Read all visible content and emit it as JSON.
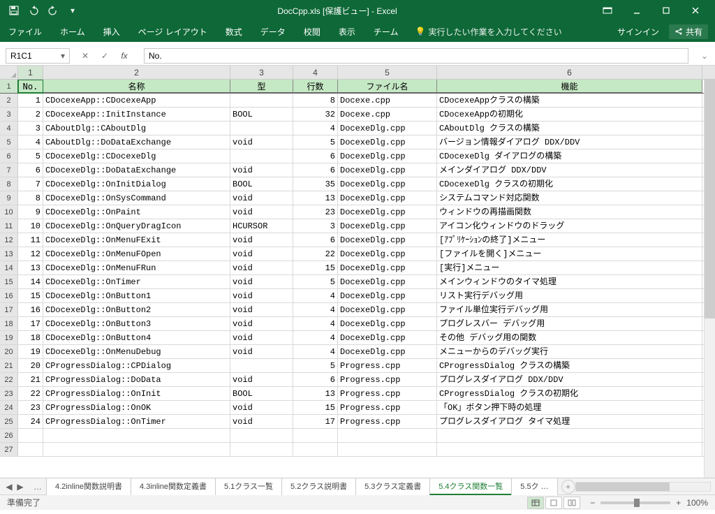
{
  "title": "DocCpp.xls [保護ビュー] - Excel",
  "qat": {
    "save": "保存",
    "undo": "元に戻す",
    "redo": "やり直し"
  },
  "ribbon": [
    "ファイル",
    "ホーム",
    "挿入",
    "ページ レイアウト",
    "数式",
    "データ",
    "校閲",
    "表示",
    "チーム"
  ],
  "tell_me": "実行したい作業を入力してください",
  "signin": "サインイン",
  "share": "共有",
  "namebox": "R1C1",
  "fx_value": "No.",
  "col_numbers": [
    "1",
    "2",
    "3",
    "4",
    "5",
    "6"
  ],
  "headers": {
    "c1": "No.",
    "c2": "名称",
    "c3": "型",
    "c4": "行数",
    "c5": "ファイル名",
    "c6": "機能"
  },
  "rows": [
    {
      "n": "1",
      "name": "CDocexeApp::CDocexeApp",
      "type": "",
      "lines": "8",
      "file": "Docexe.cpp",
      "func": "CDocexeAppクラスの構築"
    },
    {
      "n": "2",
      "name": "CDocexeApp::InitInstance",
      "type": "BOOL",
      "lines": "32",
      "file": "Docexe.cpp",
      "func": "CDocexeAppの初期化"
    },
    {
      "n": "3",
      "name": "CAboutDlg::CAboutDlg",
      "type": "",
      "lines": "4",
      "file": "DocexeDlg.cpp",
      "func": "CAboutDlg クラスの構築"
    },
    {
      "n": "4",
      "name": "CAboutDlg::DoDataExchange",
      "type": "void",
      "lines": "5",
      "file": "DocexeDlg.cpp",
      "func": "バージョン情報ダイアログ DDX/DDV"
    },
    {
      "n": "5",
      "name": "CDocexeDlg::CDocexeDlg",
      "type": "",
      "lines": "6",
      "file": "DocexeDlg.cpp",
      "func": "CDocexeDlg ダイアログの構築"
    },
    {
      "n": "6",
      "name": "CDocexeDlg::DoDataExchange",
      "type": "void",
      "lines": "6",
      "file": "DocexeDlg.cpp",
      "func": "メインダイアログ DDX/DDV"
    },
    {
      "n": "7",
      "name": "CDocexeDlg::OnInitDialog",
      "type": "BOOL",
      "lines": "35",
      "file": "DocexeDlg.cpp",
      "func": "CDocexeDlg クラスの初期化"
    },
    {
      "n": "8",
      "name": "CDocexeDlg::OnSysCommand",
      "type": "void",
      "lines": "13",
      "file": "DocexeDlg.cpp",
      "func": "システムコマンド対応関数"
    },
    {
      "n": "9",
      "name": "CDocexeDlg::OnPaint",
      "type": "void",
      "lines": "23",
      "file": "DocexeDlg.cpp",
      "func": "ウィンドウの再描画関数"
    },
    {
      "n": "10",
      "name": "CDocexeDlg::OnQueryDragIcon",
      "type": "HCURSOR",
      "lines": "3",
      "file": "DocexeDlg.cpp",
      "func": "アイコン化ウィンドウのドラッグ"
    },
    {
      "n": "11",
      "name": "CDocexeDlg::OnMenuFExit",
      "type": "void",
      "lines": "6",
      "file": "DocexeDlg.cpp",
      "func": "[ｱﾌﾟﾘｹｰｼｮﾝの終了]メニュー"
    },
    {
      "n": "12",
      "name": "CDocexeDlg::OnMenuFOpen",
      "type": "void",
      "lines": "22",
      "file": "DocexeDlg.cpp",
      "func": "[ファイルを開く]メニュー"
    },
    {
      "n": "13",
      "name": "CDocexeDlg::OnMenuFRun",
      "type": "void",
      "lines": "15",
      "file": "DocexeDlg.cpp",
      "func": "[実行]メニュー"
    },
    {
      "n": "14",
      "name": "CDocexeDlg::OnTimer",
      "type": "void",
      "lines": "5",
      "file": "DocexeDlg.cpp",
      "func": "メインウィンドウのタイマ処理"
    },
    {
      "n": "15",
      "name": "CDocexeDlg::OnButton1",
      "type": "void",
      "lines": "4",
      "file": "DocexeDlg.cpp",
      "func": "リスト実行デバッグ用"
    },
    {
      "n": "16",
      "name": "CDocexeDlg::OnButton2",
      "type": "void",
      "lines": "4",
      "file": "DocexeDlg.cpp",
      "func": "ファイル単位実行デバッグ用"
    },
    {
      "n": "17",
      "name": "CDocexeDlg::OnButton3",
      "type": "void",
      "lines": "4",
      "file": "DocexeDlg.cpp",
      "func": "プログレスバー デバッグ用"
    },
    {
      "n": "18",
      "name": "CDocexeDlg::OnButton4",
      "type": "void",
      "lines": "4",
      "file": "DocexeDlg.cpp",
      "func": "その他 デバッグ用の関数"
    },
    {
      "n": "19",
      "name": "CDocexeDlg::OnMenuDebug",
      "type": "void",
      "lines": "4",
      "file": "DocexeDlg.cpp",
      "func": "メニューからのデバッグ実行"
    },
    {
      "n": "20",
      "name": "CProgressDialog::CPDialog",
      "type": "",
      "lines": "5",
      "file": "Progress.cpp",
      "func": "CProgressDialog クラスの構築"
    },
    {
      "n": "21",
      "name": "CProgressDialog::DoData",
      "type": "void",
      "lines": "6",
      "file": "Progress.cpp",
      "func": "プログレスダイアログ DDX/DDV"
    },
    {
      "n": "22",
      "name": "CProgressDialog::OnInit",
      "type": "BOOL",
      "lines": "13",
      "file": "Progress.cpp",
      "func": "CProgressDialog クラスの初期化"
    },
    {
      "n": "23",
      "name": "CProgressDialog::OnOK",
      "type": "void",
      "lines": "15",
      "file": "Progress.cpp",
      "func": "「OK」ボタン押下時の処理"
    },
    {
      "n": "24",
      "name": "CProgressDialog::OnTimer",
      "type": "void",
      "lines": "17",
      "file": "Progress.cpp",
      "func": "プログレスダイアログ タイマ処理"
    }
  ],
  "sheets": [
    "4.2inline関数説明書",
    "4.3inline関数定義書",
    "5.1クラス一覧",
    "5.2クラス説明書",
    "5.3クラス定義書",
    "5.4クラス関数一覧",
    "5.5ク …"
  ],
  "active_sheet": 5,
  "status": "準備完了",
  "zoom": "100%"
}
